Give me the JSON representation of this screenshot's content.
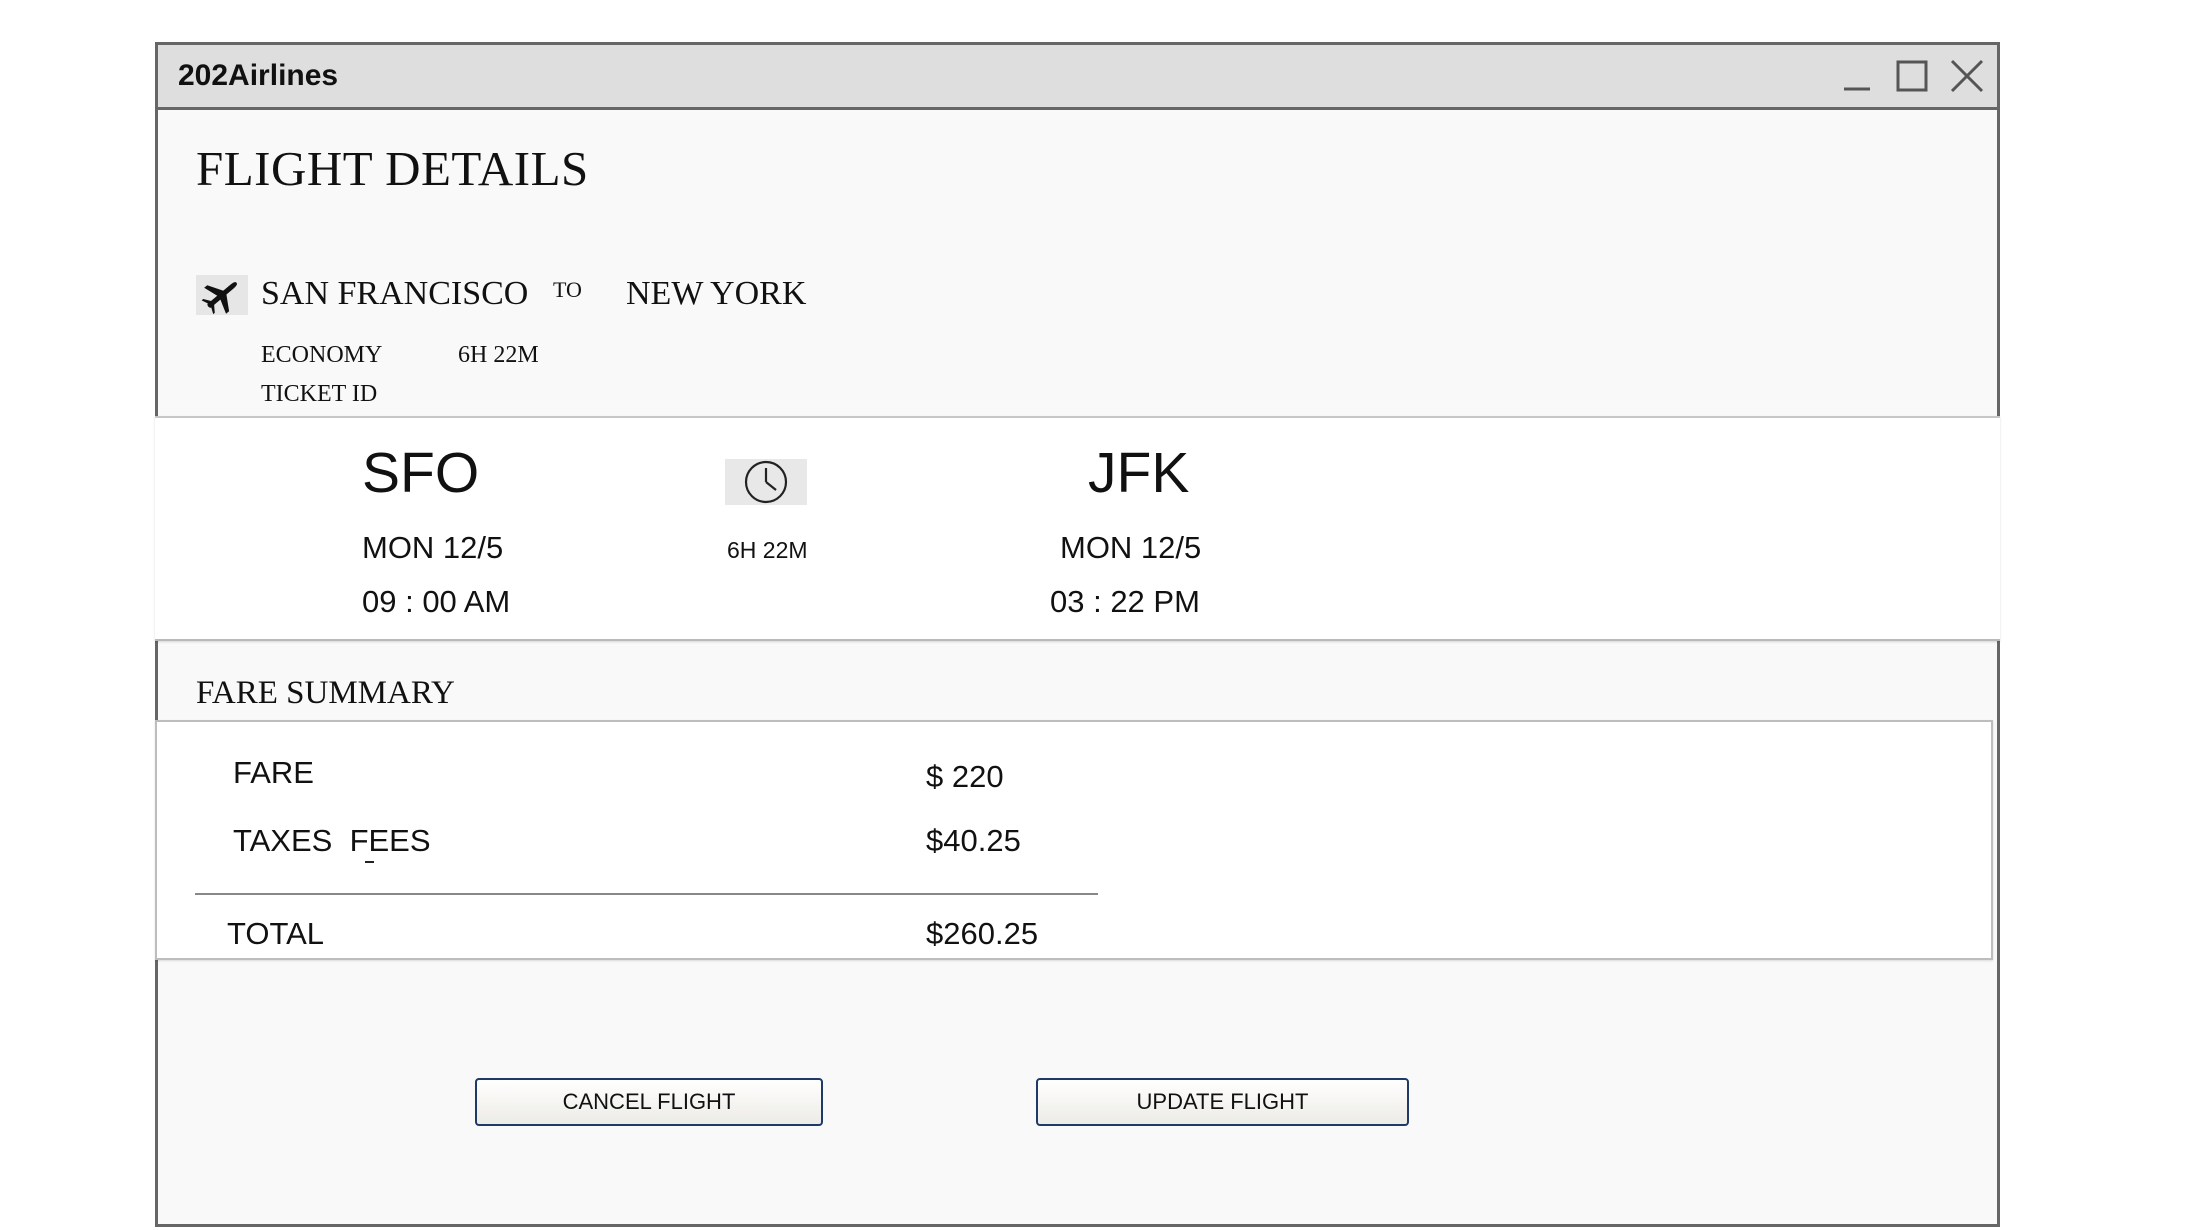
{
  "window": {
    "title": "202Airlines",
    "controls": {
      "minimize_icon": "minimize-icon",
      "maximize_icon": "maximize-icon",
      "close_icon": "close-icon"
    }
  },
  "page": {
    "title": "FLIGHT DETAILS"
  },
  "route": {
    "icon": "airplane-icon",
    "origin_city": "SAN FRANCISCO",
    "to_label": "TO",
    "destination_city": "NEW YORK",
    "cabin_class": "ECONOMY",
    "duration": "6H 22M",
    "ticket_id_label": "TICKET ID"
  },
  "flight": {
    "departure": {
      "code": "SFO",
      "date": "MON 12/5",
      "time": "09 : 00 AM"
    },
    "duration_icon": "clock-icon",
    "duration": "6H 22M",
    "arrival": {
      "code": "JFK",
      "date": "MON 12/5",
      "time": "03 : 22 PM"
    }
  },
  "fare_summary": {
    "heading": "FARE SUMMARY",
    "rows": [
      {
        "label": "FARE",
        "value": "$ 220"
      },
      {
        "label": "TAXES  FEES",
        "value": "$40.25"
      }
    ],
    "total": {
      "label": "TOTAL",
      "value": "$260.25"
    }
  },
  "actions": {
    "cancel_label": "CANCEL FLIGHT",
    "update_label": "UPDATE FLIGHT"
  }
}
